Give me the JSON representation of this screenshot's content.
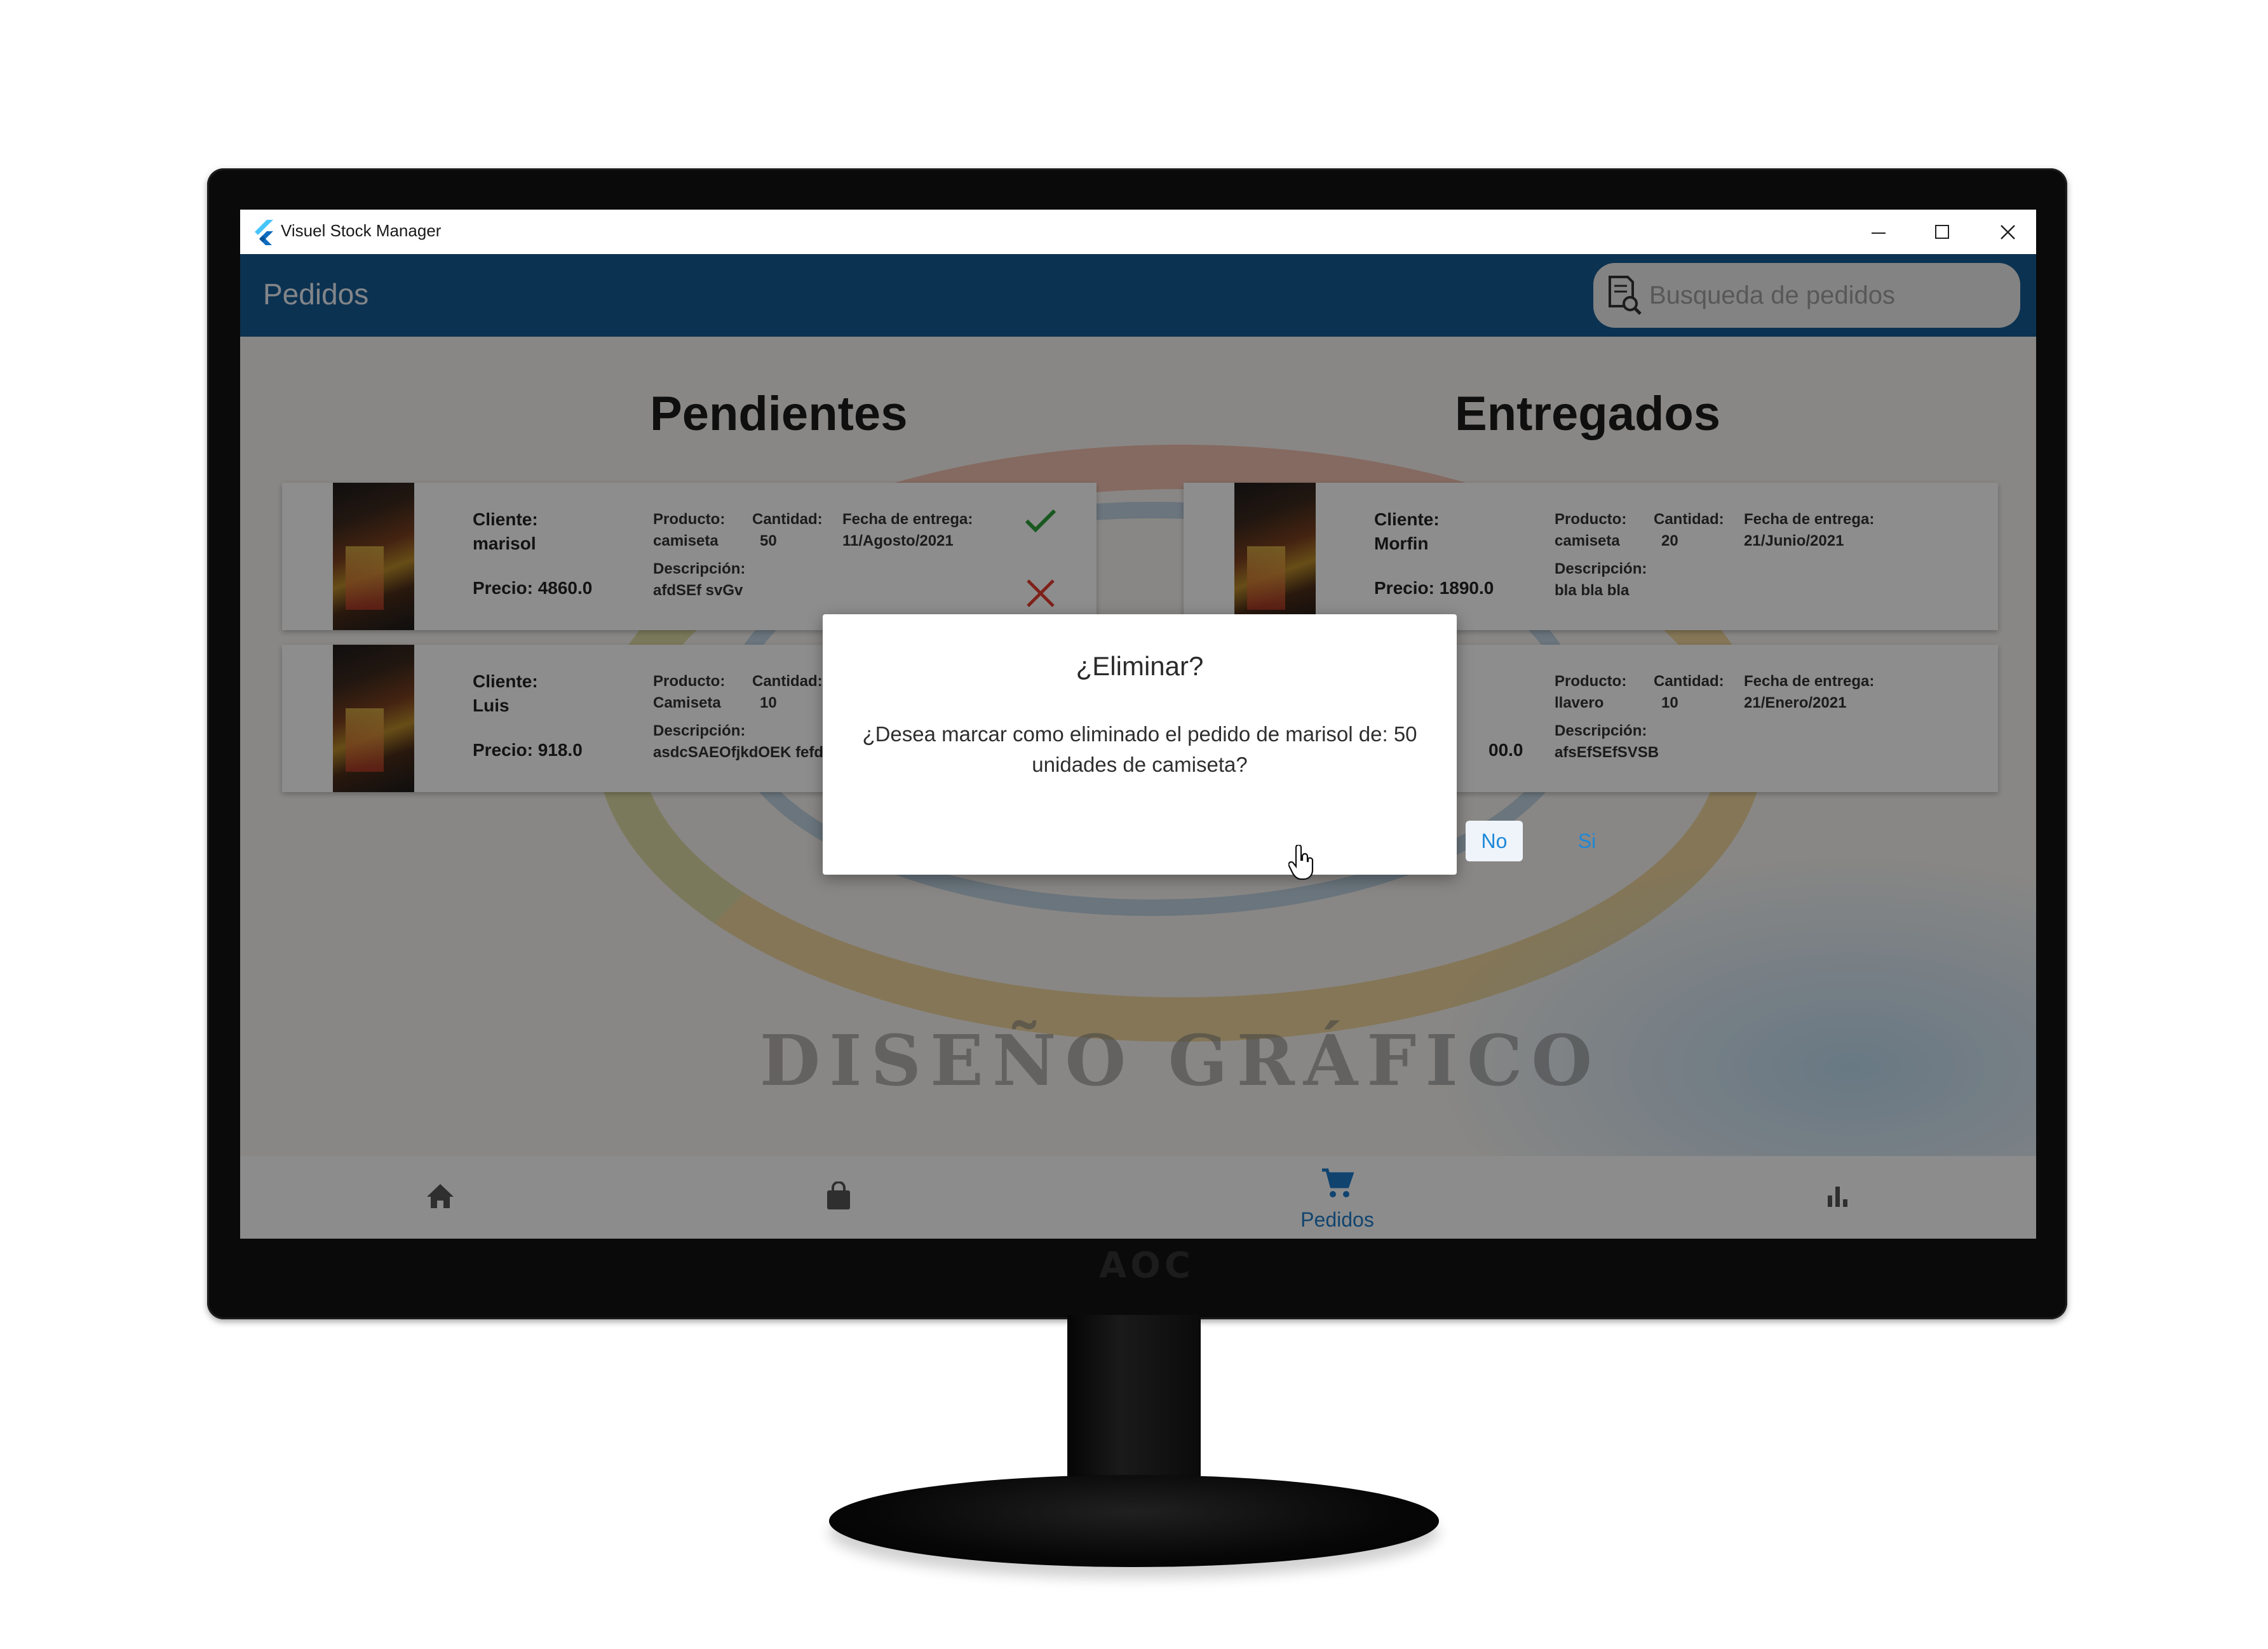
{
  "window": {
    "title": "Visuel Stock Manager"
  },
  "appbar": {
    "title": "Pedidos",
    "search_placeholder": "Busqueda de pedidos"
  },
  "background": {
    "watermark": "DISEÑO GRÁFICO"
  },
  "columns": {
    "pending_title": "Pendientes",
    "delivered_title": "Entregados"
  },
  "labels": {
    "cliente": "Cliente:",
    "precio": "Precio:",
    "producto": "Producto:",
    "cantidad": "Cantidad:",
    "fecha": "Fecha de entrega:",
    "descripcion": "Descripción:"
  },
  "pending": [
    {
      "cliente": "marisol",
      "precio": "Precio: 4860.0",
      "producto": "camiseta",
      "cantidad": "50",
      "fecha": "11/Agosto/2021",
      "descripcion": "afdSEf svGv"
    },
    {
      "cliente": "Luis",
      "precio": "Precio: 918.0",
      "producto": "Camiseta",
      "cantidad": "10",
      "fecha": "",
      "descripcion": "asdcSAEOfjkdOEK fefd"
    }
  ],
  "delivered": [
    {
      "cliente": "Morfin",
      "precio": "Precio: 1890.0",
      "producto": "camiseta",
      "cantidad": "20",
      "fecha": "21/Junio/2021",
      "descripcion": "bla bla bla"
    },
    {
      "cliente": "",
      "precio": "00.0",
      "producto": "llavero",
      "cantidad": "10",
      "fecha": "21/Enero/2021",
      "descripcion": "afsEfSEfSVSB"
    }
  ],
  "dialog": {
    "title": "¿Eliminar?",
    "body": "¿Desea marcar como eliminado el pedido de marisol de: 50 unidades de camiseta?",
    "no_label": "No",
    "si_label": "Si"
  },
  "nav": {
    "active_label": "Pedidos",
    "icons": [
      "home-icon",
      "shopping-bag-icon",
      "cart-icon",
      "bar-chart-icon"
    ]
  },
  "colors": {
    "appbar": "#175a91",
    "accent": "#1e88d8",
    "check": "#2e9e3a",
    "cross": "#e23b2e"
  },
  "monitor": {
    "brand": "AOC"
  }
}
